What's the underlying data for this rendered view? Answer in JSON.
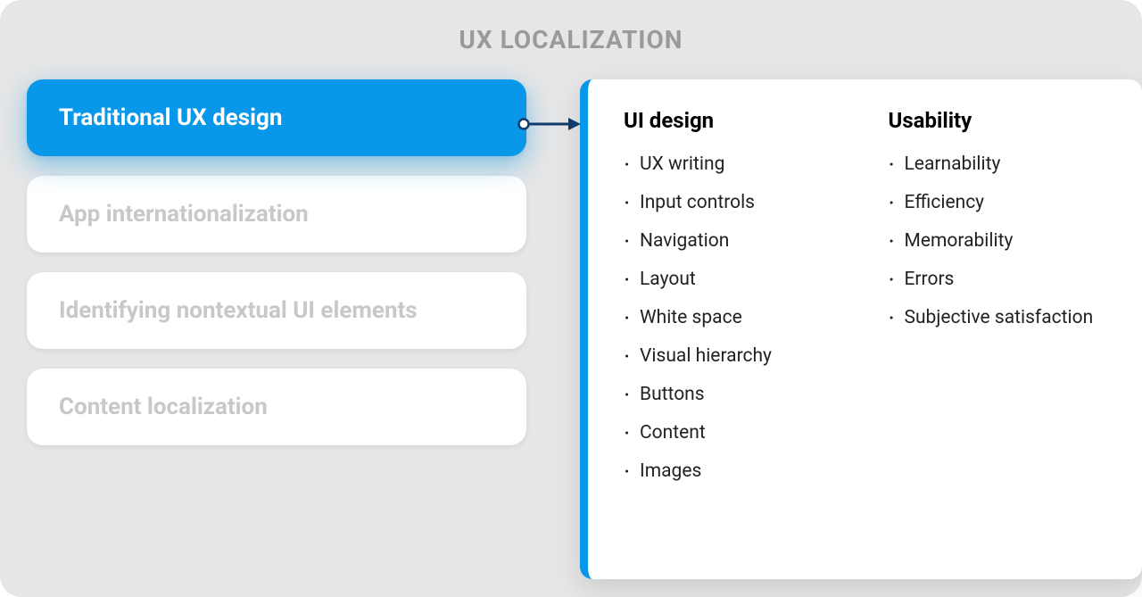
{
  "title": "UX LOCALIZATION",
  "cards": [
    {
      "label": "Traditional UX design",
      "active": true
    },
    {
      "label": "App internationalization",
      "active": false
    },
    {
      "label": "Identifying nontextual UI elements",
      "active": false
    },
    {
      "label": "Content localization",
      "active": false
    }
  ],
  "detail": {
    "columns": [
      {
        "heading": "UI design",
        "items": [
          "UX writing",
          "Input controls",
          "Navigation",
          "Layout",
          "White space",
          "Visual hierarchy",
          "Buttons",
          "Content",
          "Images"
        ]
      },
      {
        "heading": "Usability",
        "items": [
          "Learnability",
          "Efficiency",
          "Memorability",
          "Errors",
          "Subjective satisfaction"
        ]
      }
    ]
  },
  "colors": {
    "accent": "#0897e9",
    "muted": "#9a9a9a",
    "bg": "#e6e6e6"
  }
}
